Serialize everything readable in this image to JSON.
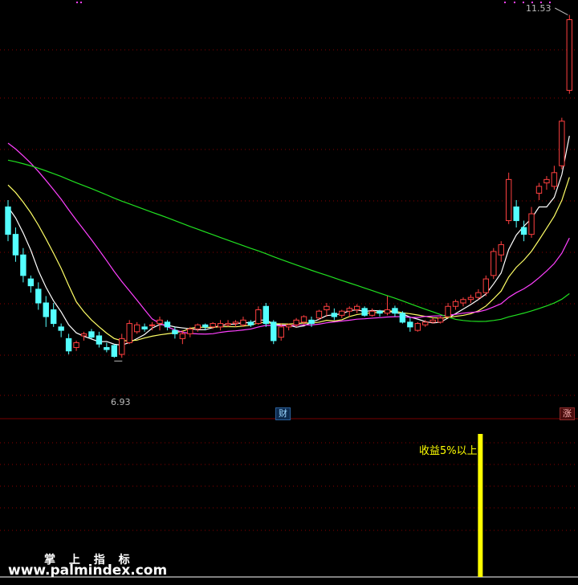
{
  "chart_data": {
    "type": "candlestick",
    "price_ylim": [
      5.9,
      11.7
    ],
    "annotations": {
      "high_label": "11.53",
      "low_label": "6.93"
    },
    "tags": {
      "cai": "财",
      "zhang": "涨"
    },
    "colors": {
      "up": "#ff4040",
      "down": "#54ffff",
      "ma_fast": "#ffffff",
      "ma_mid": "#ffff66",
      "ma_slow": "#ff40ff",
      "ma_long": "#20e020",
      "signal": "#ffff00",
      "grid": "#8a0000"
    },
    "candles": [
      [
        8.8,
        8.9,
        8.3,
        8.4
      ],
      [
        8.4,
        8.5,
        8.0,
        8.1
      ],
      [
        8.1,
        8.2,
        7.7,
        7.8
      ],
      [
        7.75,
        7.8,
        7.55,
        7.65
      ],
      [
        7.6,
        7.7,
        7.3,
        7.4
      ],
      [
        7.4,
        7.5,
        7.05,
        7.2
      ],
      [
        7.3,
        7.4,
        7.05,
        7.1
      ],
      [
        7.05,
        7.1,
        6.9,
        7.0
      ],
      [
        6.88,
        6.95,
        6.65,
        6.7
      ],
      [
        6.75,
        6.85,
        6.7,
        6.82
      ],
      [
        6.92,
        6.98,
        6.85,
        6.95
      ],
      [
        6.98,
        7.02,
        6.88,
        6.9
      ],
      [
        6.92,
        6.98,
        6.75,
        6.8
      ],
      [
        6.75,
        6.82,
        6.68,
        6.72
      ],
      [
        6.78,
        6.8,
        6.6,
        6.62
      ],
      [
        6.65,
        6.95,
        6.6,
        6.88
      ],
      [
        6.82,
        7.15,
        6.8,
        7.1
      ],
      [
        6.98,
        7.12,
        6.95,
        7.08
      ],
      [
        7.05,
        7.1,
        6.98,
        7.02
      ],
      [
        7.08,
        7.12,
        7.0,
        7.08
      ],
      [
        7.1,
        7.2,
        7.0,
        7.15
      ],
      [
        7.12,
        7.15,
        7.0,
        7.05
      ],
      [
        7.0,
        7.05,
        6.88,
        6.95
      ],
      [
        6.88,
        7.0,
        6.8,
        6.95
      ],
      [
        6.95,
        7.05,
        6.9,
        7.02
      ],
      [
        7.02,
        7.1,
        6.98,
        7.08
      ],
      [
        7.08,
        7.1,
        7.0,
        7.05
      ],
      [
        7.05,
        7.12,
        7.02,
        7.1
      ],
      [
        7.05,
        7.15,
        7.0,
        7.1
      ],
      [
        7.08,
        7.15,
        7.05,
        7.1
      ],
      [
        7.1,
        7.15,
        7.05,
        7.12
      ],
      [
        7.08,
        7.2,
        7.05,
        7.15
      ],
      [
        7.12,
        7.15,
        7.05,
        7.08
      ],
      [
        7.1,
        7.35,
        7.08,
        7.3
      ],
      [
        7.35,
        7.4,
        7.05,
        7.1
      ],
      [
        7.12,
        7.15,
        6.8,
        6.85
      ],
      [
        6.9,
        7.1,
        6.85,
        7.05
      ],
      [
        7.05,
        7.1,
        7.0,
        7.08
      ],
      [
        7.08,
        7.18,
        7.05,
        7.15
      ],
      [
        7.12,
        7.22,
        7.08,
        7.2
      ],
      [
        7.15,
        7.2,
        7.05,
        7.1
      ],
      [
        7.18,
        7.3,
        7.15,
        7.28
      ],
      [
        7.3,
        7.4,
        7.2,
        7.35
      ],
      [
        7.25,
        7.32,
        7.15,
        7.2
      ],
      [
        7.22,
        7.3,
        7.18,
        7.28
      ],
      [
        7.28,
        7.35,
        7.2,
        7.32
      ],
      [
        7.3,
        7.38,
        7.25,
        7.35
      ],
      [
        7.32,
        7.35,
        7.2,
        7.22
      ],
      [
        7.22,
        7.32,
        7.2,
        7.28
      ],
      [
        7.28,
        7.3,
        7.2,
        7.25
      ],
      [
        7.25,
        7.5,
        7.22,
        7.3
      ],
      [
        7.32,
        7.36,
        7.2,
        7.25
      ],
      [
        7.25,
        7.28,
        7.1,
        7.12
      ],
      [
        7.12,
        7.18,
        6.98,
        7.05
      ],
      [
        7.0,
        7.12,
        6.98,
        7.1
      ],
      [
        7.08,
        7.15,
        7.05,
        7.12
      ],
      [
        7.12,
        7.18,
        7.1,
        7.15
      ],
      [
        7.12,
        7.2,
        7.1,
        7.18
      ],
      [
        7.2,
        7.4,
        7.18,
        7.35
      ],
      [
        7.35,
        7.45,
        7.3,
        7.42
      ],
      [
        7.4,
        7.48,
        7.35,
        7.45
      ],
      [
        7.45,
        7.52,
        7.4,
        7.48
      ],
      [
        7.48,
        7.6,
        7.45,
        7.55
      ],
      [
        7.55,
        7.8,
        7.5,
        7.75
      ],
      [
        7.8,
        8.2,
        7.75,
        8.15
      ],
      [
        8.1,
        8.3,
        8.0,
        8.25
      ],
      [
        8.6,
        9.3,
        8.55,
        9.2
      ],
      [
        8.8,
        8.9,
        8.5,
        8.6
      ],
      [
        8.5,
        8.6,
        8.3,
        8.4
      ],
      [
        8.4,
        8.8,
        8.35,
        8.7
      ],
      [
        9.0,
        9.15,
        8.9,
        9.1
      ],
      [
        9.15,
        9.25,
        9.05,
        9.2
      ],
      [
        9.1,
        9.4,
        9.05,
        9.3
      ],
      [
        9.4,
        10.1,
        9.35,
        10.05
      ],
      [
        10.5,
        11.6,
        10.45,
        11.53
      ]
    ],
    "signal": {
      "index": 63,
      "value": 1,
      "label": "收益5%以上!"
    }
  },
  "brand": {
    "title": "掌 上 指 标",
    "url": "www.palmindex.com"
  }
}
